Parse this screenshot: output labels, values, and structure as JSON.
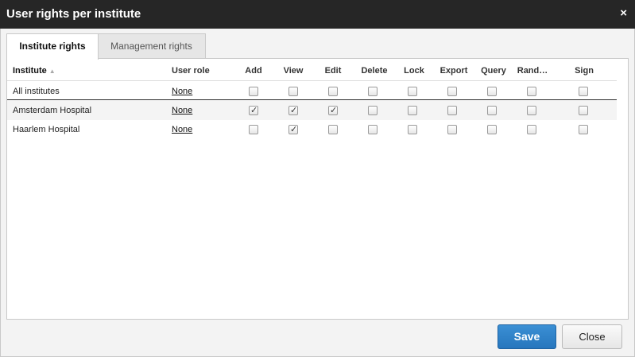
{
  "dialog": {
    "title": "User rights per institute",
    "close_icon": "close-icon",
    "close_glyph": "×"
  },
  "tabs": [
    {
      "label": "Institute rights",
      "active": true
    },
    {
      "label": "Management rights",
      "active": false
    }
  ],
  "table": {
    "columns": [
      "Institute",
      "User role",
      "Add",
      "View",
      "Edit",
      "Delete",
      "Lock",
      "Export",
      "Query",
      "Rand…",
      "Sign"
    ],
    "sort_indicator": "▲",
    "rows": [
      {
        "institute": "All institutes",
        "user_role": "None",
        "checks": [
          false,
          false,
          false,
          false,
          false,
          false,
          false,
          false,
          false
        ]
      },
      {
        "institute": "Amsterdam Hospital",
        "user_role": "None",
        "checks": [
          true,
          true,
          true,
          false,
          false,
          false,
          false,
          false,
          false
        ]
      },
      {
        "institute": "Haarlem Hospital",
        "user_role": "None",
        "checks": [
          false,
          true,
          false,
          false,
          false,
          false,
          false,
          false,
          false
        ]
      }
    ]
  },
  "buttons": {
    "save": "Save",
    "close": "Close"
  },
  "colors": {
    "titlebar": "#262626",
    "save_button": "#2f82c8"
  }
}
